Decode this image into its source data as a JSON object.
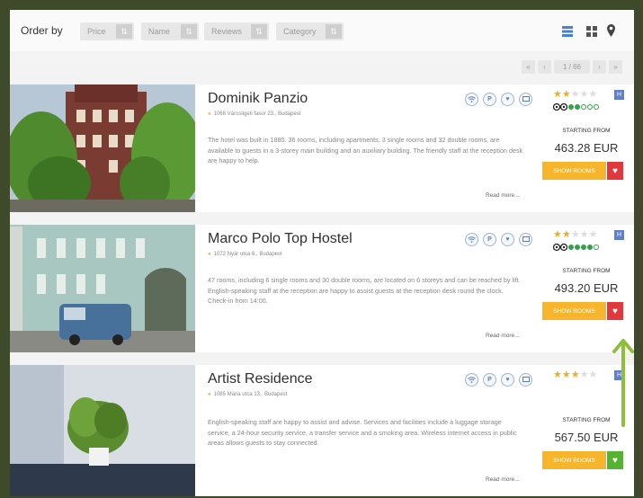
{
  "toolbar": {
    "order_label": "Order by",
    "sort_buttons": [
      {
        "label": "Price"
      },
      {
        "label": "Name"
      },
      {
        "label": "Reviews"
      },
      {
        "label": "Category"
      }
    ],
    "view_icons": [
      "list-view-icon",
      "grid-view-icon",
      "map-pin-icon"
    ]
  },
  "pager": {
    "first": "«",
    "prev": "‹",
    "page": "1 / 66",
    "next": "›",
    "last": "»"
  },
  "colors": {
    "accent_orange": "#f7b52b",
    "heart_red": "#e0383d",
    "heart_green": "#55b233",
    "annotation_arrow": "#8fbf3a",
    "star_gold": "#f2ad1e"
  },
  "hotels": [
    {
      "name": "Dominik Panzio",
      "address": "1068 Városligeti fasor 23., Budapest",
      "description": "The hotel was built in 1880. 36 rooms, including apartments, 3 single rooms and 32 double rooms, are available to guests in a 3-storey main building and an auxiliary building. The friendly staff at the reception desk are happy to help.",
      "read_more": "Read more...",
      "stars": 2,
      "category": "H",
      "tripadvisor_rating": 2,
      "starting_from": "STARTING FROM",
      "price": "463.28 EUR",
      "button": "SHOW ROOMS",
      "heart_state": "red"
    },
    {
      "name": "Marco Polo Top Hostel",
      "address": "1072 Nyár utca 6., Budapest",
      "description": "47 rooms, including 6 single rooms and 30 double rooms, are located on 6 storeys and can be reached by lift. English-speaking staff at the reception are happy to assist guests at the reception desk round the clock. Check-in from 14:00.",
      "read_more": "Read more...",
      "stars": 2,
      "category": "H",
      "tripadvisor_rating": 4,
      "starting_from": "STARTING FROM",
      "price": "493.20 EUR",
      "button": "SHOW ROOMS",
      "heart_state": "red"
    },
    {
      "name": "Artist Residence",
      "address": "1085 Mária utca 13., Budapest",
      "description": "English-speaking staff are happy to assist and advise. Services and facilities include a luggage storage service, a 24-hour security service, a transfer service and a smoking area. Wireless internet access in public areas allows guests to stay connected.",
      "read_more": "Read more...",
      "stars": 3,
      "category": "H",
      "tripadvisor_rating": 0,
      "starting_from": "STARTING FROM",
      "price": "567.50 EUR",
      "button": "SHOW ROOMS",
      "heart_state": "green"
    }
  ]
}
